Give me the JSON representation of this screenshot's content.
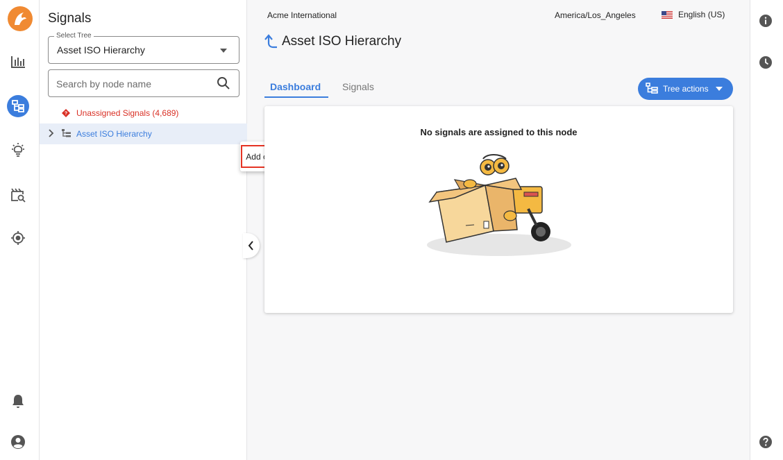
{
  "panel": {
    "title": "Signals",
    "select_tree": {
      "label": "Select Tree",
      "value": "Asset ISO Hierarchy"
    },
    "search": {
      "placeholder": "Search by node name",
      "value": ""
    },
    "tree": {
      "unassigned": "Unassigned Signals (4,689)",
      "root": "Asset ISO Hierarchy"
    }
  },
  "context_menu": {
    "item": "Add child node"
  },
  "topbar": {
    "org": "Acme International",
    "timezone": "America/Los_Angeles",
    "language": "English (US)"
  },
  "main": {
    "title": "Asset ISO Hierarchy",
    "tabs": [
      {
        "label": "Dashboard",
        "active": true
      },
      {
        "label": "Signals",
        "active": false
      }
    ],
    "tree_actions_label": "Tree actions",
    "empty_message": "No signals are assigned to this node"
  },
  "colors": {
    "accent": "#3b7ddd",
    "brand": "#f08a32",
    "error": "#d93025",
    "highlight": "#e53323"
  },
  "icons": {
    "rail": [
      "app-logo-icon",
      "analytics-icon",
      "tree-icon",
      "lightbulb-icon",
      "search-clip-icon",
      "target-icon",
      "bell-icon",
      "account-icon"
    ],
    "right_rail": [
      "info-icon",
      "history-icon",
      "help-icon"
    ]
  }
}
